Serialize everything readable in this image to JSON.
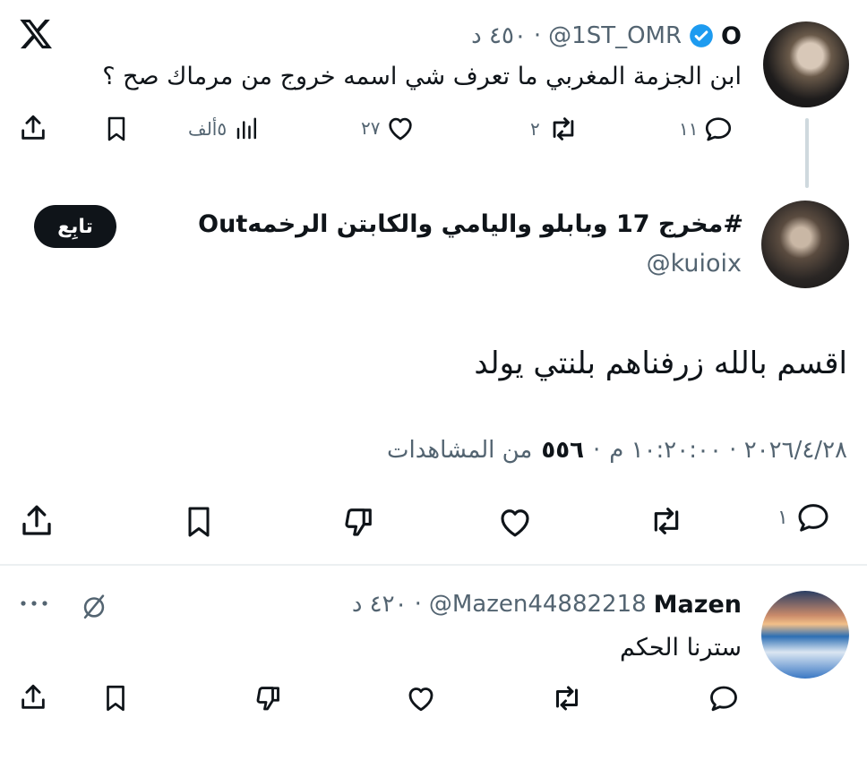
{
  "colors": {
    "text": "#0f1419",
    "muted": "#536471",
    "verified": "#1d9bf0",
    "button": "#0f1419"
  },
  "top_tweet": {
    "display_name": "O",
    "handle": "@1ST_OMR",
    "time": "٤٥٠ د",
    "text": "ابن الجزمة المغربي ما تعرف شي اسمه خروج من مرماك صح ؟",
    "replies": "١١",
    "retweets": "٢",
    "likes": "٢٧",
    "views": "٥ألف",
    "icons": [
      "x-logo-icon",
      "verified-badge-icon",
      "reply-icon",
      "retweet-icon",
      "like-icon",
      "views-icon",
      "bookmark-icon",
      "share-icon"
    ]
  },
  "main_tweet": {
    "display_name": "#مخرج 17 وبابلو واليامي والكابتن الرخمهOut",
    "handle": "@kuioix",
    "follow_label": "تابِع",
    "text": "اقسم بالله زرفناهم بلنتي يولد",
    "timestamp": "٢٠٢٦/٤/٢٨ · ١٠:٢٠:٠٠ م",
    "views_count": "٥٥٦",
    "views_label": "من المشاهدات",
    "replies": "١",
    "icons": [
      "reply-icon",
      "retweet-icon",
      "like-icon",
      "dislike-icon",
      "bookmark-icon",
      "share-icon"
    ]
  },
  "reply_tweet": {
    "display_name": "Mazen",
    "handle": "@Mazen44882218",
    "time": "٤٢٠ د",
    "text": "سترنا الحكم",
    "icons": [
      "more-icon",
      "muted-icon",
      "reply-icon",
      "retweet-icon",
      "like-icon",
      "dislike-icon",
      "bookmark-icon",
      "share-icon"
    ]
  }
}
